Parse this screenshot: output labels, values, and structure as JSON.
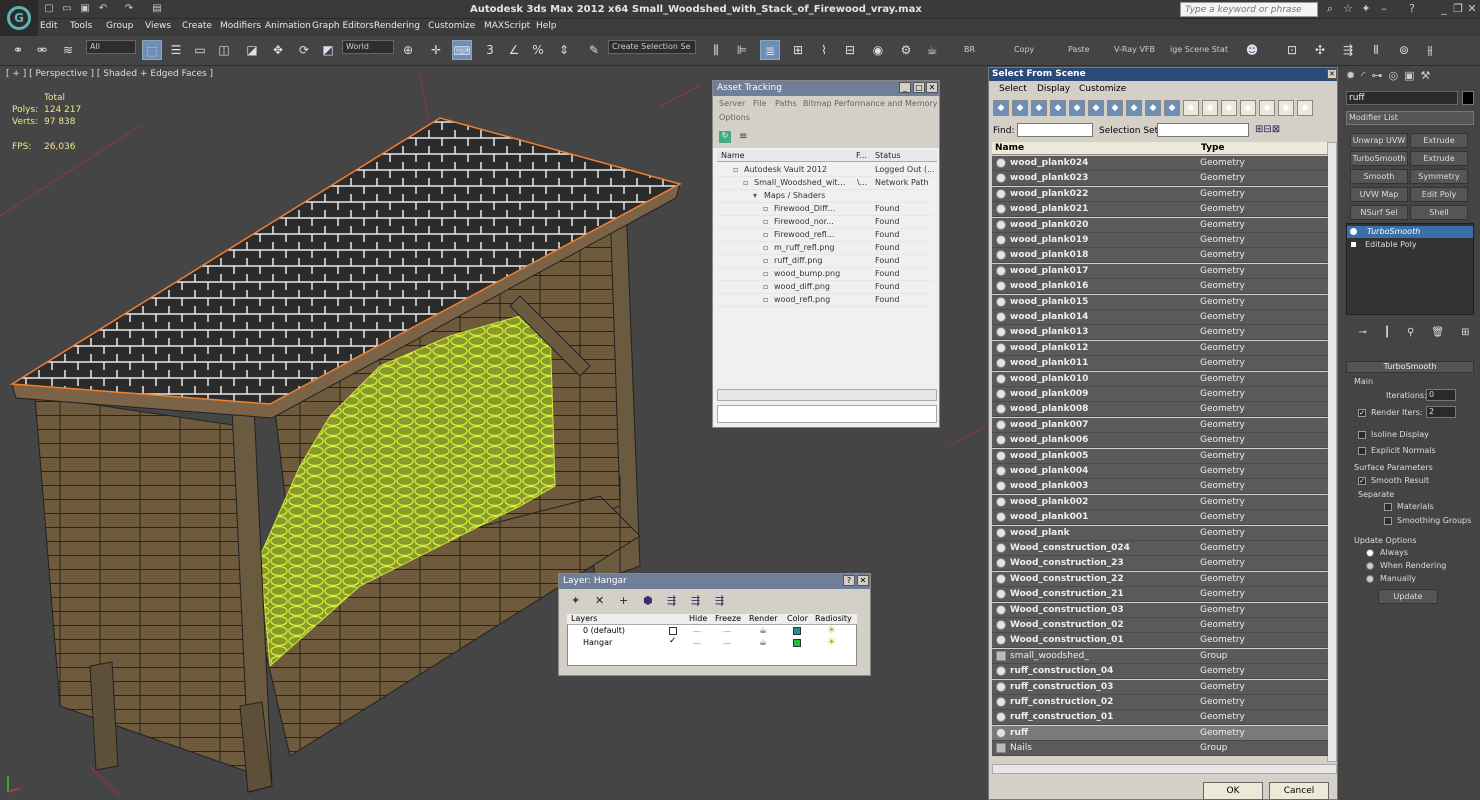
{
  "app": {
    "title": "Autodesk 3ds Max  2012 x64     Small_Woodshed_with_Stack_of_Firewood_vray.max",
    "logo_letter": "G",
    "search_placeholder": "Type a keyword or phrase"
  },
  "menubar": [
    "Edit",
    "Tools",
    "Group",
    "Views",
    "Create",
    "Modifiers",
    "Animation",
    "Graph Editors",
    "Rendering",
    "Customize",
    "MAXScript",
    "Help"
  ],
  "toolbar": {
    "filter_value": "All",
    "coord_value": "World",
    "selection_set_placeholder": "Create Selection Se",
    "labels": [
      "BR",
      "Copy",
      "Paste",
      "V-Ray VFB",
      "ige Scene Stat"
    ]
  },
  "viewport": {
    "label": "[ + ] [ Perspective ] [ Shaded + Edged Faces ]",
    "stats_header": "Total",
    "stats": [
      {
        "label": "Polys:",
        "value": "124 217"
      },
      {
        "label": "Verts:",
        "value": "97 838"
      }
    ],
    "fps_label": "FPS:",
    "fps_value": "26,036"
  },
  "asset_tracking": {
    "title": "Asset Tracking",
    "menu": [
      "Server",
      "File",
      "Paths",
      "Bitmap Performance and Memory"
    ],
    "menu2": [
      "Options"
    ],
    "headers": [
      "Name",
      "F...",
      "Status"
    ],
    "rows": [
      {
        "name": "Autodesk Vault 2012",
        "f": "",
        "status": "Logged Out (...",
        "indent": 1
      },
      {
        "name": "Small_Woodshed_wit...",
        "f": "\\...",
        "status": "Network Path",
        "indent": 2
      },
      {
        "name": "Maps / Shaders",
        "f": "",
        "status": "",
        "indent": 3
      },
      {
        "name": "Firewood_Diff...",
        "f": "",
        "status": "Found",
        "indent": 4
      },
      {
        "name": "Firewood_nor...",
        "f": "",
        "status": "Found",
        "indent": 4
      },
      {
        "name": "Firewood_refl...",
        "f": "",
        "status": "Found",
        "indent": 4
      },
      {
        "name": "m_ruff_refl.png",
        "f": "",
        "status": "Found",
        "indent": 4
      },
      {
        "name": "ruff_diff.png",
        "f": "",
        "status": "Found",
        "indent": 4
      },
      {
        "name": "wood_bump.png",
        "f": "",
        "status": "Found",
        "indent": 4
      },
      {
        "name": "wood_diff.png",
        "f": "",
        "status": "Found",
        "indent": 4
      },
      {
        "name": "wood_refl.png",
        "f": "",
        "status": "Found",
        "indent": 4
      }
    ]
  },
  "layer_dialog": {
    "title": "Layer: Hangar",
    "headers": [
      "Layers",
      "Hide",
      "Freeze",
      "Render",
      "Color",
      "Radiosity"
    ],
    "rows": [
      {
        "name": "0 (default)",
        "color": "#1f8f8f"
      },
      {
        "name": "Hangar",
        "color": "#22bb44"
      }
    ]
  },
  "select_from_scene": {
    "title": "Select From Scene",
    "menu": [
      "Select",
      "Display",
      "Customize"
    ],
    "find_label": "Find:",
    "selection_set_label": "Selection Set:",
    "headers": [
      "Name",
      "Type"
    ],
    "rows": [
      {
        "name": "wood_plank024",
        "type": "Geometry"
      },
      {
        "name": "wood_plank023",
        "type": "Geometry"
      },
      {
        "name": "wood_plank022",
        "type": "Geometry"
      },
      {
        "name": "wood_plank021",
        "type": "Geometry"
      },
      {
        "name": "wood_plank020",
        "type": "Geometry"
      },
      {
        "name": "wood_plank019",
        "type": "Geometry"
      },
      {
        "name": "wood_plank018",
        "type": "Geometry"
      },
      {
        "name": "wood_plank017",
        "type": "Geometry"
      },
      {
        "name": "wood_plank016",
        "type": "Geometry"
      },
      {
        "name": "wood_plank015",
        "type": "Geometry"
      },
      {
        "name": "wood_plank014",
        "type": "Geometry"
      },
      {
        "name": "wood_plank013",
        "type": "Geometry"
      },
      {
        "name": "wood_plank012",
        "type": "Geometry"
      },
      {
        "name": "wood_plank011",
        "type": "Geometry"
      },
      {
        "name": "wood_plank010",
        "type": "Geometry"
      },
      {
        "name": "wood_plank009",
        "type": "Geometry"
      },
      {
        "name": "wood_plank008",
        "type": "Geometry"
      },
      {
        "name": "wood_plank007",
        "type": "Geometry"
      },
      {
        "name": "wood_plank006",
        "type": "Geometry"
      },
      {
        "name": "wood_plank005",
        "type": "Geometry"
      },
      {
        "name": "wood_plank004",
        "type": "Geometry"
      },
      {
        "name": "wood_plank003",
        "type": "Geometry"
      },
      {
        "name": "wood_plank002",
        "type": "Geometry"
      },
      {
        "name": "wood_plank001",
        "type": "Geometry"
      },
      {
        "name": "wood_plank",
        "type": "Geometry"
      },
      {
        "name": "Wood_construction_024",
        "type": "Geometry"
      },
      {
        "name": "Wood_construction_23",
        "type": "Geometry"
      },
      {
        "name": "Wood_construction_22",
        "type": "Geometry"
      },
      {
        "name": "Wood_construction_21",
        "type": "Geometry"
      },
      {
        "name": "Wood_construction_03",
        "type": "Geometry"
      },
      {
        "name": "Wood_construction_02",
        "type": "Geometry"
      },
      {
        "name": "Wood_construction_01",
        "type": "Geometry"
      },
      {
        "name": "small_woodshed_",
        "type": "Group",
        "group": true
      },
      {
        "name": "ruff_construction_04",
        "type": "Geometry"
      },
      {
        "name": "ruff_construction_03",
        "type": "Geometry"
      },
      {
        "name": "ruff_construction_02",
        "type": "Geometry"
      },
      {
        "name": "ruff_construction_01",
        "type": "Geometry"
      },
      {
        "name": "ruff",
        "type": "Geometry",
        "selected": true
      },
      {
        "name": "Nails",
        "type": "Group",
        "group": true
      }
    ],
    "ok_label": "OK",
    "cancel_label": "Cancel"
  },
  "command_panel": {
    "object_name": "ruff",
    "modifier_list_label": "Modifier List",
    "modifier_buttons": [
      "Unwrap UVW",
      "Extrude",
      "TurboSmooth",
      "Extrude",
      "Smooth",
      "Symmetry",
      "UVW Map",
      "Edit Poly",
      "NSurf Sel",
      "Shell"
    ],
    "stack": [
      "TurboSmooth",
      "Editable Poly"
    ],
    "rollout_title": "TurboSmooth",
    "main_label": "Main",
    "iterations_label": "Iterations:",
    "iterations_value": "0",
    "render_iters_label": "Render Iters:",
    "render_iters_value": "2",
    "isoline_label": "Isoline Display",
    "explicit_normals_label": "Explicit Normals",
    "surface_params_label": "Surface Parameters",
    "smooth_result_label": "Smooth Result",
    "separate_label": "Separate",
    "materials_label": "Materials",
    "smoothing_groups_label": "Smoothing Groups",
    "update_options_label": "Update Options",
    "always_label": "Always",
    "when_rendering_label": "When Rendering",
    "manually_label": "Manually",
    "update_button": "Update"
  }
}
